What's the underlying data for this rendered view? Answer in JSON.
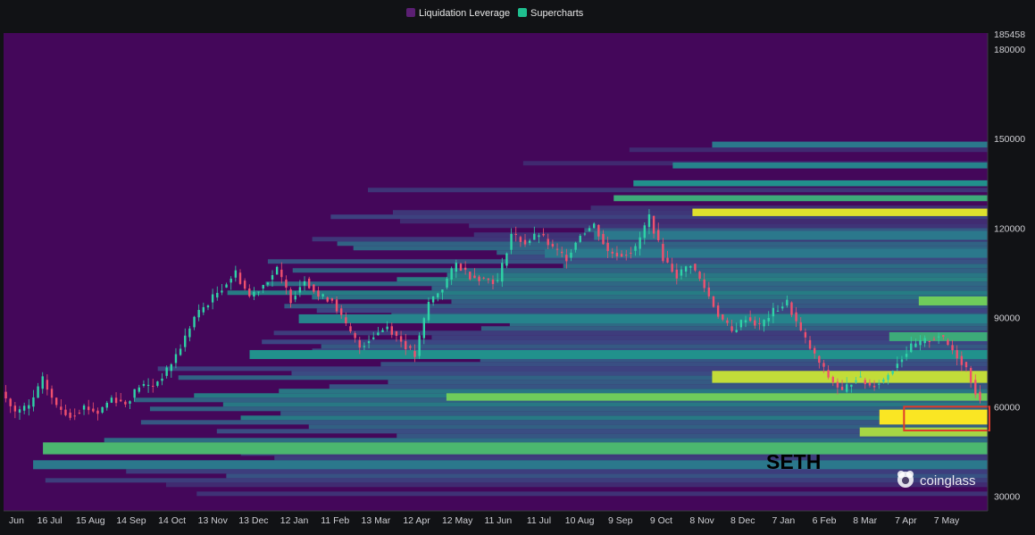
{
  "colors": {
    "background": "#111215",
    "plot_base": "#44075a",
    "legend_liquidation": "#5b1f73",
    "legend_supercharts": "#1fbf8f",
    "highlight_box": "#e03a2a",
    "watermark_text": "#ffffff",
    "annotation_text": "#000000"
  },
  "legend": [
    {
      "label": "Liquidation Leverage",
      "color": "#5b1f73"
    },
    {
      "label": "Supercharts",
      "color": "#1fbf8f"
    }
  ],
  "annotation_text": "SETH",
  "watermark": {
    "label": "coinglass",
    "icon": "coinglass-logo-icon"
  },
  "chart_data": {
    "type": "heatmap",
    "title": "",
    "xlabel": "",
    "ylabel": "",
    "ylim": [
      25000,
      185458
    ],
    "yticks": [
      180000,
      150000,
      120000,
      90000,
      60000,
      30000
    ],
    "y_top_label": "185458",
    "grid": false,
    "legend_placement": "top-center",
    "x_tick_labels": [
      "Jun",
      "16 Jul",
      "15 Aug",
      "14 Sep",
      "14 Oct",
      "13 Nov",
      "13 Dec",
      "12 Jan",
      "11 Feb",
      "13 Mar",
      "12 Apr",
      "12 May",
      "11 Jun",
      "11 Jul",
      "10 Aug",
      "9 Sep",
      "9 Oct",
      "8 Nov",
      "8 Dec",
      "7 Jan",
      "6 Feb",
      "8 Mar",
      "7 Apr",
      "7 May"
    ],
    "price_series": {
      "name": "",
      "values": [
        65000,
        58000,
        60000,
        69000,
        60000,
        57000,
        60000,
        58000,
        63000,
        61000,
        67000,
        67000,
        72000,
        80000,
        90000,
        95000,
        100000,
        105000,
        97000,
        101000,
        106000,
        96000,
        103000,
        97000,
        96000,
        87000,
        80000,
        84000,
        87000,
        82000,
        77000,
        95000,
        100000,
        108000,
        104000,
        103000,
        102000,
        118000,
        115000,
        118000,
        113000,
        110000,
        118000,
        121000,
        112000,
        111000,
        113000,
        124000,
        110000,
        104000,
        108000,
        100000,
        91000,
        85000,
        90000,
        87000,
        92000,
        95000,
        85000,
        77000,
        70000,
        65000,
        70000,
        67000,
        69000,
        75000,
        80000,
        82000,
        84000,
        79000,
        73000,
        61000
      ]
    },
    "bands": [
      {
        "from": 54000,
        "to": 59000,
        "start_fraction": 0.89,
        "intensity": 1.0
      },
      {
        "from": 50000,
        "to": 53000,
        "start_fraction": 0.87,
        "intensity": 0.85
      },
      {
        "from": 68000,
        "to": 72000,
        "start_fraction": 0.72,
        "intensity": 0.9
      },
      {
        "from": 124000,
        "to": 126500,
        "start_fraction": 0.7,
        "intensity": 0.95
      },
      {
        "from": 44000,
        "to": 48000,
        "start_fraction": 0.04,
        "intensity": 0.65
      },
      {
        "from": 62000,
        "to": 64500,
        "start_fraction": 0.45,
        "intensity": 0.75
      },
      {
        "from": 94000,
        "to": 97000,
        "start_fraction": 0.93,
        "intensity": 0.75
      },
      {
        "from": 82000,
        "to": 85000,
        "start_fraction": 0.9,
        "intensity": 0.6
      },
      {
        "from": 129000,
        "to": 131000,
        "start_fraction": 0.62,
        "intensity": 0.6
      },
      {
        "from": 134000,
        "to": 136000,
        "start_fraction": 0.64,
        "intensity": 0.5
      },
      {
        "from": 140000,
        "to": 142000,
        "start_fraction": 0.68,
        "intensity": 0.45
      },
      {
        "from": 147000,
        "to": 149000,
        "start_fraction": 0.72,
        "intensity": 0.4
      },
      {
        "from": 76000,
        "to": 79000,
        "start_fraction": 0.25,
        "intensity": 0.5
      },
      {
        "from": 88000,
        "to": 91000,
        "start_fraction": 0.3,
        "intensity": 0.45
      },
      {
        "from": 39000,
        "to": 42000,
        "start_fraction": 0.03,
        "intensity": 0.4
      },
      {
        "from": 110000,
        "to": 113000,
        "start_fraction": 0.55,
        "intensity": 0.4
      },
      {
        "from": 116000,
        "to": 119000,
        "start_fraction": 0.6,
        "intensity": 0.4
      }
    ],
    "highlight_region": {
      "y_from": 52000,
      "y_to": 60000,
      "x_start_fraction": 0.915
    }
  }
}
